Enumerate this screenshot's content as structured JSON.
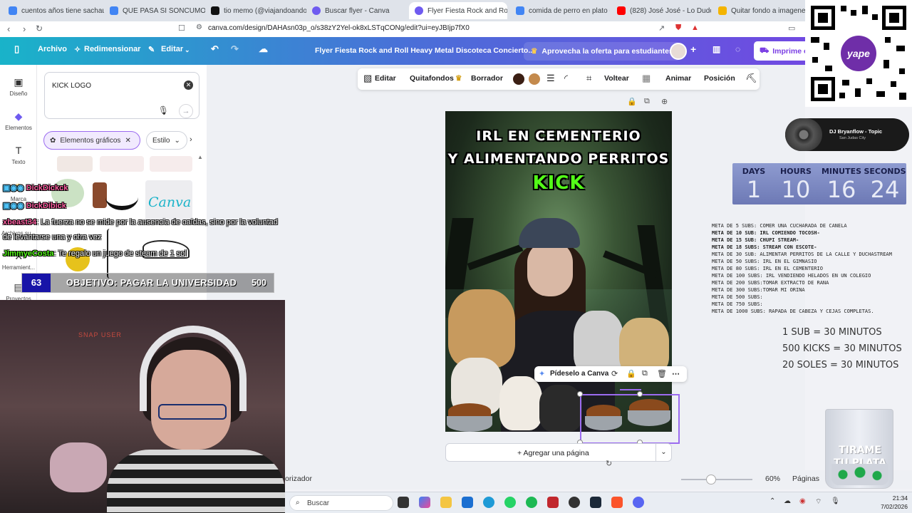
{
  "browser": {
    "tabs": [
      {
        "label": "cuentos años tiene sachauzum",
        "color": "#4285f4"
      },
      {
        "label": "QUE PASA SI SONCUMO MUC",
        "color": "#4285f4"
      },
      {
        "label": "tio memo (@viajandoando590",
        "color": "#111111"
      },
      {
        "label": "Buscar flyer - Canva",
        "color": "#6f5bf0"
      },
      {
        "label": "Flyer Fiesta Rock and Roll",
        "color": "#6f5bf0"
      },
      {
        "label": "comida de perro en plato - Bu",
        "color": "#4285f4"
      },
      {
        "label": "(828) José José - Lo Dudo",
        "color": "#ff0000"
      },
      {
        "label": "Quitar fondo a imagenes onlin",
        "color": "#f4b400"
      }
    ],
    "url": "canva.com/design/DAHAsn03p_o/s38zY2Yel-ok8xLSTqCONg/edit?ui=eyJBIjp7fX0"
  },
  "header": {
    "archivo": "Archivo",
    "redimensionar": "Redimensionar",
    "editar": "Editar",
    "doc_title": "Flyer Fiesta Rock and Roll Heavy Metal Discoteca Concierto...",
    "promo": "Aprovecha la oferta para estudiantes",
    "imprime": "Imprime c"
  },
  "rail": {
    "diseno": "Diseño",
    "elementos": "Elementos",
    "texto": "Texto",
    "marca": "Marca",
    "archivos": "Archivos su...",
    "herramientas": "Herramient...",
    "proyectos": "Proyectos"
  },
  "panel": {
    "search_value": "KICK LOGO",
    "filter_chip": "Elementos gráficos",
    "style_chip": "Estilo",
    "canva_logo": "Canva"
  },
  "toolbar": {
    "editar": "Editar",
    "quitafondos": "Quitafondos",
    "borrador": "Borrador",
    "color1": "#3b1f14",
    "color2": "#c48a4d",
    "voltear": "Voltear",
    "animar": "Animar",
    "posicion": "Posición"
  },
  "flyer": {
    "line1": "IRL EN CEMENTERIO",
    "line2": "Y ALIMENTANDO PERRITOS",
    "kick": "KICK"
  },
  "selection": {
    "ask_label": "Pídeselo a Canva"
  },
  "add_page": "+ Agregar una página",
  "status": {
    "notes": "orizador",
    "zoom": "60%",
    "zoom_level": 0.42,
    "pages": "Páginas"
  },
  "taskbar": {
    "search": "Buscar",
    "time": "21:34",
    "date": "7/02/2026"
  },
  "stream": {
    "chat": [
      {
        "user": "DickDickck",
        "msg": ""
      },
      {
        "user": "DickDibick",
        "msg": ""
      },
      {
        "user": "xbeast34",
        "msg": ": La fuerza no se mide por la ausencia de caídas, sino por la voluntad"
      },
      {
        "user": "",
        "msg": "de levantarse una y otra vez"
      },
      {
        "user": "JimmyeCosta",
        "msg": ": Te regalo un juego de steam de 1 sol"
      }
    ],
    "goal": {
      "left": "63",
      "text": "OBJETIVO: PAGAR LA UNIVERSIDAD",
      "right": "500"
    },
    "webcam_sign": "SNAP USER",
    "qr_badge": "yape",
    "music": {
      "title": "DJ Bryanflow - Topic",
      "artist": "San Judas City"
    },
    "countdown": [
      {
        "label": "DAYS",
        "value": "1"
      },
      {
        "label": "HOURS",
        "value": "10"
      },
      {
        "label": "MINUTES",
        "value": "16"
      },
      {
        "label": "SECONDS",
        "value": "24"
      }
    ],
    "goals": [
      {
        "text": "META DE 5 SUBS: COMER UNA CUCHARADA DE CANELA",
        "bold": false
      },
      {
        "text": "META DE 10 SUB: IRL COMIENDO TOCOSH-",
        "bold": true
      },
      {
        "text": "META DE 15 SUB: CHUPI STREAM-",
        "bold": true
      },
      {
        "text": "META DE 18 SUBS: STREAM CON ESCOTE-",
        "bold": true
      },
      {
        "text": "META DE 30 SUB:  ALIMENTAR PERRITOS DE LA CALLE Y DUCHASTREAM",
        "bold": false
      },
      {
        "text": "META DE 50 SUBS: IRL EN EL GIMNASIO",
        "bold": false
      },
      {
        "text": "META DE 80 SUBS: IRL EN EL CEMENTERIO",
        "bold": false
      },
      {
        "text": "META DE 100 SUBS: IRL VENDIENDO HELADOS EN UN COLEGIO",
        "bold": false
      },
      {
        "text": "META DE 200 SUBS:TOMAR EXTRACTO DE RANA",
        "bold": false
      },
      {
        "text": "META DE 300 SUBS:TOMAR MI ORINA",
        "bold": false
      },
      {
        "text": "META DE 500 SUBS:",
        "bold": false
      },
      {
        "text": "META DE 750 SUBS:",
        "bold": false
      },
      {
        "text": "META DE 1000 SUBS: RAPADA DE CABEZA Y CEJAS COMPLETAS.",
        "bold": false
      }
    ],
    "rates": [
      "1 SUB = 30 MINUTOS",
      "500 KICKS = 30 MINUTOS",
      "20 SOLES = 30 MINUTOS"
    ],
    "cup_text_1": "TIRAME",
    "cup_text_2": "TU PLATA"
  }
}
